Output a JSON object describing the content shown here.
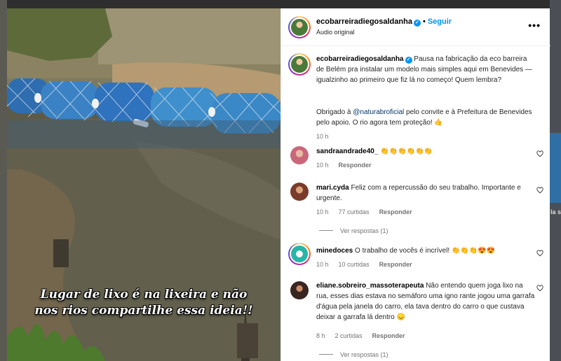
{
  "media": {
    "caption_line1": "Lugar de lixo  é na lixeira e não",
    "caption_line2": "nos rios compartilhe essa ideia!!"
  },
  "header": {
    "username": "ecobarreiradiegosaldanha",
    "separator": "•",
    "follow_label": "Seguir",
    "audio_label": "Áudio original",
    "more_icon": "more-horizontal-icon"
  },
  "post": {
    "username": "ecobarreiradiegosaldanha",
    "text_part1": "Pausa na fabricação da eco barreira de Belém pra instalar um modelo mais simples aqui em Benevides — igualzinho ao primeiro que fiz lá no começo! Quem lembra?",
    "text_part2_a": "Obrigado à ",
    "mention": "@naturabroficial",
    "text_part2_b": " pelo convite e à Prefeitura de Benevides pelo apoio. O rio agora tem proteção! 🤙",
    "time": "10 h"
  },
  "comments": [
    {
      "username": "sandraandrade40_",
      "text": "👏👏👏👏👏👏",
      "time": "10 h",
      "likes": "",
      "reply_label": "Responder",
      "view_replies": ""
    },
    {
      "username": "mari.cyda",
      "text": "Feliz com a repercussão do seu trabalho. Importante e urgente.",
      "time": "10 h",
      "likes": "77 curtidas",
      "reply_label": "Responder",
      "view_replies": "Ver respostas (1)"
    },
    {
      "username": "minedoces",
      "text": "O trabalho de vocês é incrível! 👏👏👏😍😍",
      "time": "10 h",
      "likes": "10 curtidas",
      "reply_label": "Responder",
      "view_replies": ""
    },
    {
      "username": "eliane.sobreiro_massoterapeuta",
      "text": "Não entendo quem joga lixo na rua, esses dias estava no semáforo uma igno rante jogou uma garrafa d'água pela janela do carro, ela tava dentro do carro o que custava deixar a garrafa lá dentro 😞",
      "time": "8 h",
      "likes": "2 curtidas",
      "reply_label": "Responder",
      "view_replies": "Ver respostas (1)"
    }
  ],
  "backdrop": {
    "right_label": "la\ns"
  },
  "colors": {
    "accent": "#0095f6",
    "mention": "#00376b",
    "barrier": "#2e6db0",
    "water": "#5c5a48"
  }
}
